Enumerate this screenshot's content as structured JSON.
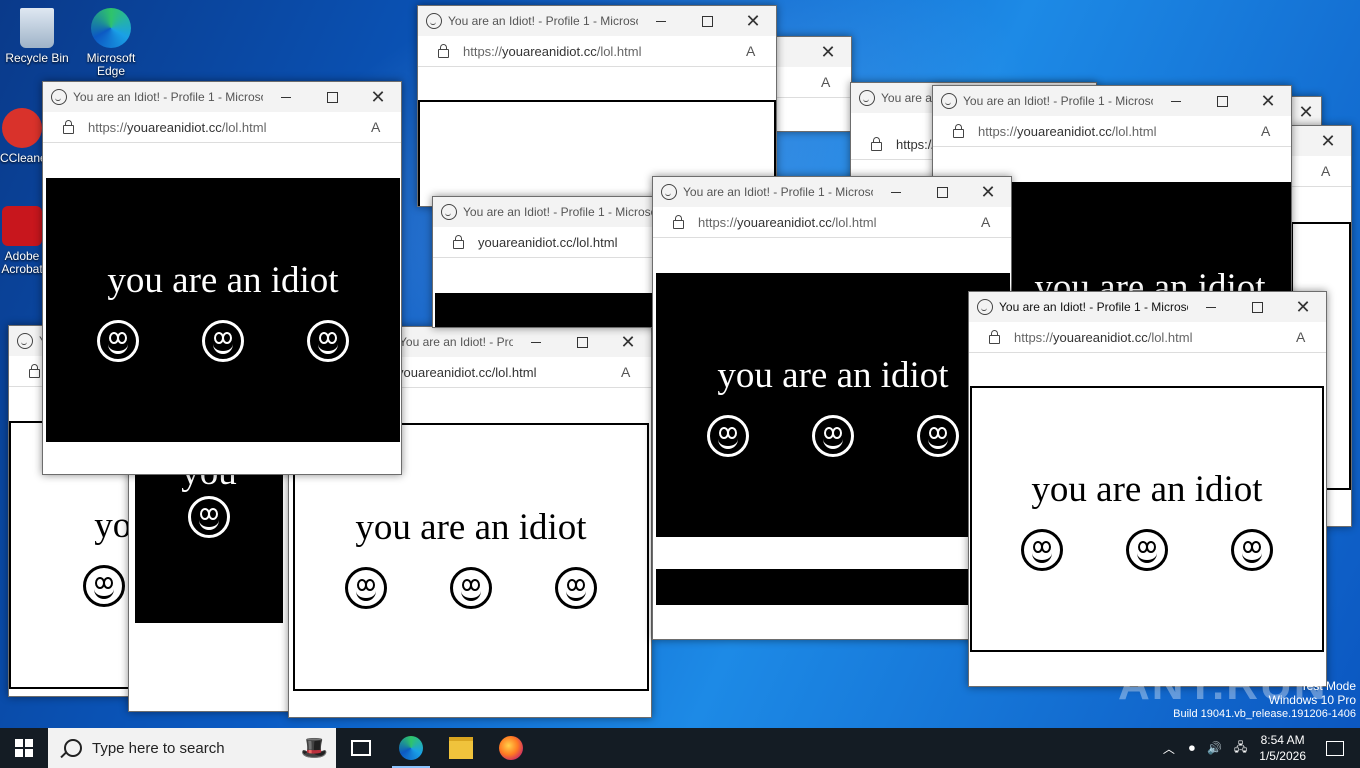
{
  "desktop": {
    "icons": [
      {
        "label": "Recycle Bin",
        "icon": "recycle-bin-icon"
      },
      {
        "label": "Microsoft Edge",
        "icon": "edge-icon"
      },
      {
        "label": "CCleaner",
        "icon": "ccleaner-icon"
      },
      {
        "label": "Adobe Acrobat",
        "icon": "acrobat-icon"
      }
    ]
  },
  "browser": {
    "title": "You are an Idiot! - Profile 1 - Microsoft Edge",
    "url_prefix": "https://",
    "url_host": "youareanidiot.cc",
    "url_path": "/lol.html",
    "url_fragment": "youareanidiot.cc/lol.html"
  },
  "page": {
    "text": "you are an idiot",
    "fragment": "you"
  },
  "watermark": {
    "line1": "Test Mode",
    "line2": "Windows 10 Pro",
    "line3": "Build 19041.vb_release.191206-1406",
    "brand": "ANY.RUN"
  },
  "taskbar": {
    "search_placeholder": "Type here to search",
    "time": "8:54 AM",
    "date": "1/5/2026"
  },
  "colors": {
    "taskbar": "#141c24",
    "accent": "#0078d4"
  }
}
